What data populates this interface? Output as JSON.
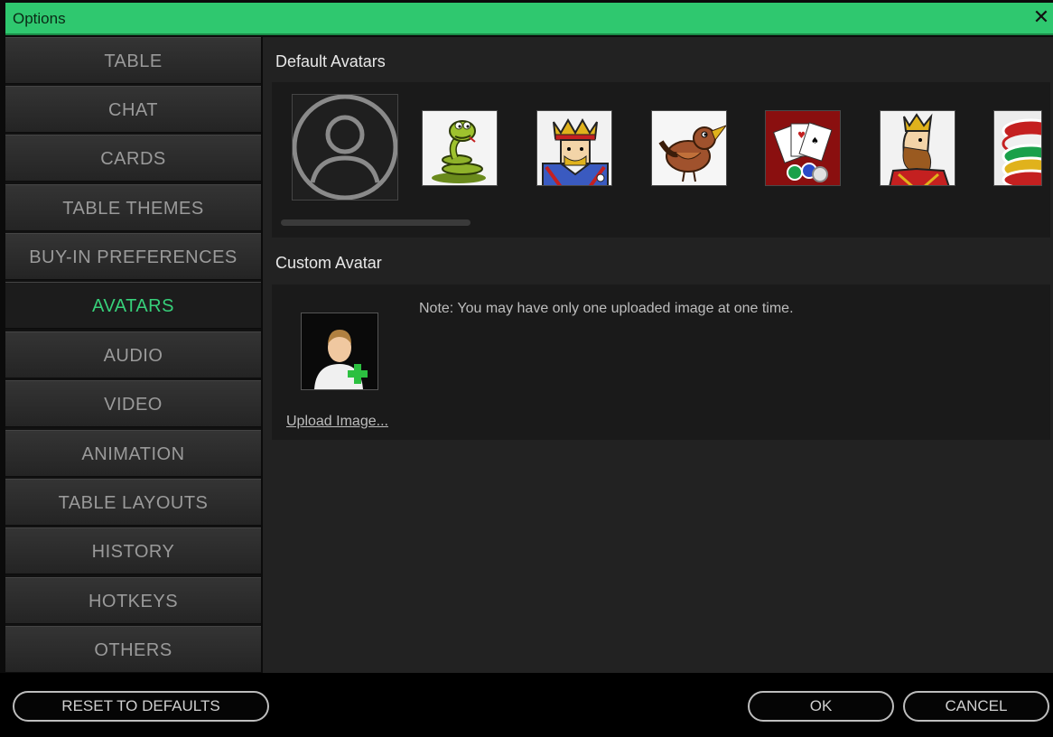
{
  "window": {
    "title": "Options",
    "close_glyph": "✕"
  },
  "sidebar": {
    "items": [
      {
        "label": "TABLE"
      },
      {
        "label": "CHAT"
      },
      {
        "label": "CARDS"
      },
      {
        "label": "TABLE THEMES"
      },
      {
        "label": "BUY-IN PREFERENCES"
      },
      {
        "label": "AVATARS",
        "active": true
      },
      {
        "label": "AUDIO"
      },
      {
        "label": "VIDEO"
      },
      {
        "label": "ANIMATION"
      },
      {
        "label": "TABLE LAYOUTS"
      },
      {
        "label": "HISTORY"
      },
      {
        "label": "HOTKEYS"
      },
      {
        "label": "OTHERS"
      }
    ]
  },
  "default_avatars": {
    "title": "Default Avatars",
    "items": [
      {
        "icon": "default-person-icon"
      },
      {
        "icon": "snake-avatar"
      },
      {
        "icon": "king-card-avatar"
      },
      {
        "icon": "bird-avatar"
      },
      {
        "icon": "playing-cards-chips-avatar"
      },
      {
        "icon": "king-profile-avatar"
      },
      {
        "icon": "poker-chips-avatar"
      }
    ]
  },
  "custom_avatar": {
    "title": "Custom Avatar",
    "note": "Note: You may have only one uploaded image at one time.",
    "upload_link": "Upload Image...",
    "upload_icon": "add-user-icon"
  },
  "footer": {
    "reset_label": "RESET TO DEFAULTS",
    "ok_label": "OK",
    "cancel_label": "CANCEL"
  },
  "colors": {
    "title_bar": "#2fc86f",
    "active_nav_text": "#37d07a",
    "panel_bg": "#1a1a1a",
    "main_bg": "#222222"
  }
}
